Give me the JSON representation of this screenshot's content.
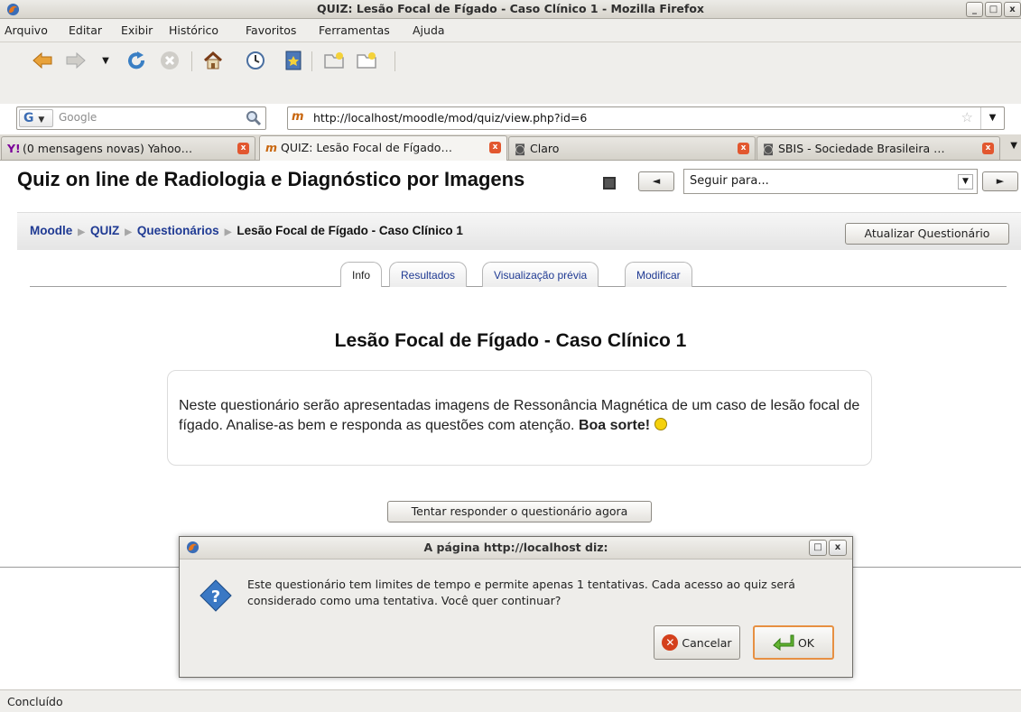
{
  "window": {
    "title": "QUIZ: Lesão Focal de Fígado - Caso Clínico 1 - Mozilla Firefox",
    "controls": [
      "_",
      "□",
      "x"
    ]
  },
  "menu": {
    "items": [
      "Arquivo",
      "Editar",
      "Exibir",
      "Histórico",
      "Favoritos",
      "Ferramentas",
      "Ajuda"
    ]
  },
  "toolbar": {
    "icons": [
      "back-arrow-icon",
      "forward-arrow-icon",
      "history-dropdown-icon",
      "reload-icon",
      "stop-icon",
      "home-icon",
      "history-clock-icon",
      "bookmark-icon",
      "new-bookmark-icon",
      "new-folder-icon"
    ]
  },
  "search": {
    "engine": "G",
    "placeholder": "Google"
  },
  "address": {
    "url": "http://localhost/moodle/mod/quiz/view.php?id=6"
  },
  "tabs": [
    {
      "label": "(0 mensagens novas) Yahoo…"
    },
    {
      "label": "QUIZ: Lesão Focal de Fígado…"
    },
    {
      "label": "Claro"
    },
    {
      "label": "SBIS - Sociedade Brasileira …"
    }
  ],
  "site": {
    "title": "Quiz on line de Radiologia e Diagnóstico por Imagens",
    "jump_placeholder": "Seguir para...",
    "prev": "◄",
    "next": "►"
  },
  "breadcrumb": {
    "items": [
      "Moodle",
      "QUIZ",
      "Questionários"
    ],
    "current": "Lesão Focal de Fígado - Caso Clínico 1",
    "update_button": "Atualizar Questionário"
  },
  "module_tabs": [
    "Info",
    "Resultados",
    "Visualização prévia",
    "Modificar"
  ],
  "quiz": {
    "title": "Lesão Focal de Fígado - Caso Clínico 1",
    "intro": "Neste questionário serão apresentadas imagens de Ressonância Magnética de um caso de lesão focal de fígado. Analise-as bem e responda as questões com atenção.",
    "intro_bold": "Boa sorte!",
    "attempt_button": "Tentar responder o questionário agora"
  },
  "dialog": {
    "title": "A página http://localhost diz:",
    "message": "Este questionário tem limites de tempo e permite apenas 1 tentativas. Cada acesso ao quiz será considerado como uma tentativa. Você quer continuar?",
    "cancel": "Cancelar",
    "ok": "OK"
  },
  "status": {
    "text": "Concluído"
  }
}
